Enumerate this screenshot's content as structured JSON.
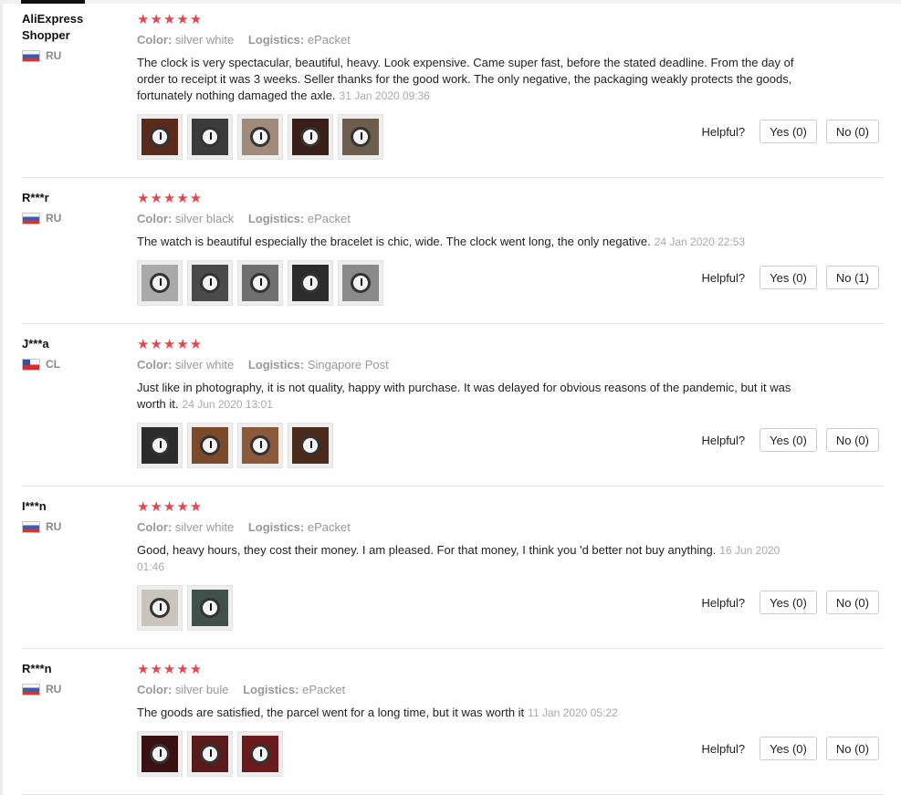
{
  "helpful_label": "Helpful?",
  "color_label": "Color:",
  "logistics_label": "Logistics:",
  "colors": {
    "star": "#e8454e",
    "muted": "#999999",
    "date": "#aaaaaa",
    "border": "#e6e6e6"
  },
  "reviews": [
    {
      "user": "AliExpress Shopper",
      "country": "RU",
      "country_flag": "ru",
      "stars": "★★★★★",
      "rating": 5,
      "color": "silver white",
      "logistics": "ePacket",
      "text": "The clock is very spectacular, beautiful, heavy. Look expensive. Came super fast, before the stated deadline. From the day of order to receipt it was 3 weeks. Seller thanks for the good work. The only negative, the packaging weakly protects the goods, fortunately nothing damaged the axle.",
      "date": "31 Jan 2020 09:36",
      "photos": 5,
      "yes": "Yes (0)",
      "no": "No (0)"
    },
    {
      "user": "R***r",
      "country": "RU",
      "country_flag": "ru",
      "stars": "★★★★★",
      "rating": 5,
      "color": "silver black",
      "logistics": "ePacket",
      "text": "The watch is beautiful especially the bracelet is chic, wide. The clock went long, the only negative.",
      "date": "24 Jan 2020 22:53",
      "photos": 5,
      "yes": "Yes (0)",
      "no": "No (1)"
    },
    {
      "user": "J***a",
      "country": "CL",
      "country_flag": "cl",
      "stars": "★★★★★",
      "rating": 5,
      "color": "silver white",
      "logistics": "Singapore Post",
      "text": "Just like in photography, it is not quality, happy with purchase. It was delayed for obvious reasons of the pandemic, but it was worth it.",
      "date": "24 Jun 2020 13:01",
      "photos": 4,
      "yes": "Yes (0)",
      "no": "No (0)"
    },
    {
      "user": "I***n",
      "country": "RU",
      "country_flag": "ru",
      "stars": "★★★★★",
      "rating": 5,
      "color": "silver white",
      "logistics": "ePacket",
      "text": "Good, heavy hours, they cost their money. I am pleased. For that money, I think you 'd better not buy anything.",
      "date": "16 Jun 2020 01:46",
      "photos": 2,
      "yes": "Yes (0)",
      "no": "No (0)"
    },
    {
      "user": "R***n",
      "country": "RU",
      "country_flag": "ru",
      "stars": "★★★★★",
      "rating": 5,
      "color": "silver bule",
      "logistics": "ePacket",
      "text": "The goods are satisfied, the parcel went for a long time, but it was worth it",
      "date": "11 Jan 2020 05:22",
      "photos": 3,
      "yes": "Yes (0)",
      "no": "No (0)"
    }
  ]
}
